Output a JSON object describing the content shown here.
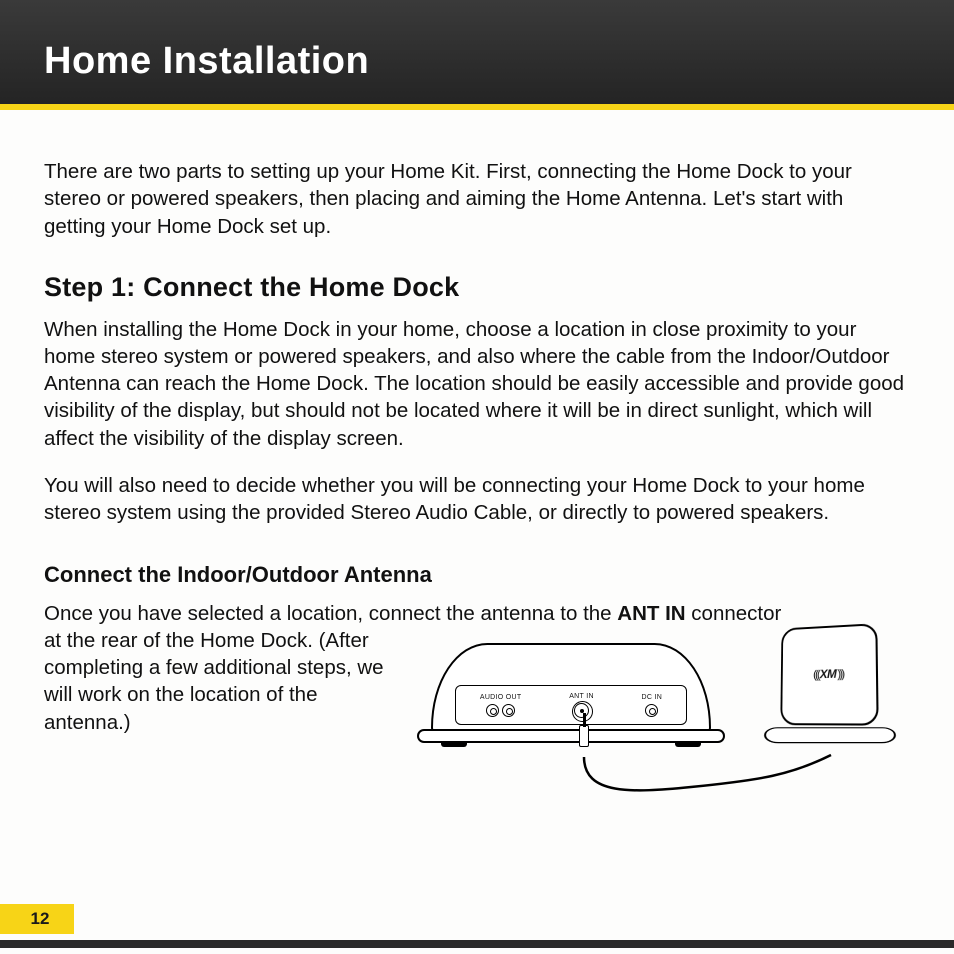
{
  "header": {
    "title": "Home Installation"
  },
  "intro": "There are two parts to setting up your Home Kit. First, connecting the Home Dock to your stereo or powered speakers, then placing and aiming the Home Antenna. Let's start with getting your Home Dock set up.",
  "step1": {
    "heading": "Step 1: Connect the Home Dock",
    "p1": "When installing the Home Dock in your home, choose a location in close proximity to your home stereo system or powered speakers, and also where the cable from the Indoor/Outdoor Antenna can reach the Home Dock. The location should be easily accessible and provide good visibility of the display, but should not be located where it will be in direct sunlight, which will affect the visibility of the display screen.",
    "p2": "You will also need to decide whether you will be connecting your Home Dock to your home stereo system using the provided Stereo Audio Cable, or directly to powered speakers."
  },
  "sub1": {
    "heading": "Connect the Indoor/Outdoor Antenna",
    "lead_a": "Once you have selected a location, connect the antenna to the ",
    "lead_bold": "ANT IN",
    "lead_b": " connector",
    "rest": "at the rear of the Home Dock. (After completing a few additional steps, we will work on the location of the antenna.)"
  },
  "diagram": {
    "ports": {
      "audio_out": "AUDIO OUT",
      "ant_in": "ANT IN",
      "dc_in": "DC IN"
    },
    "antenna_logo": "XM"
  },
  "page_number": "12"
}
